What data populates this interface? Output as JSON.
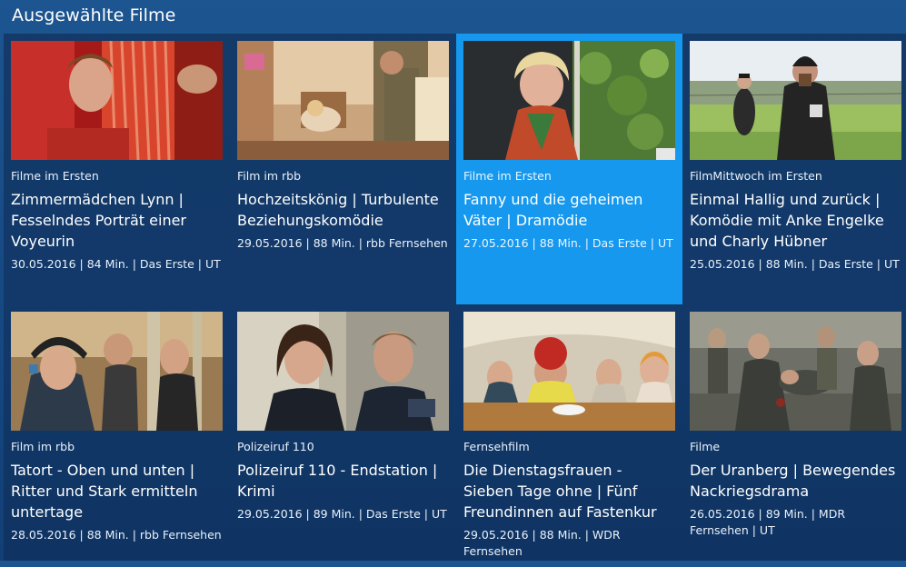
{
  "header": {
    "title": "Ausgewählte Filme"
  },
  "films": [
    {
      "channel": "Filme im Ersten",
      "title": "Zimmermädchen Lynn | Fesselndes Porträt einer Voyeurin",
      "meta": "30.05.2016 | 84 Min. | Das Erste | UT",
      "active": false
    },
    {
      "channel": "Film im rbb",
      "title": "Hochzeitskönig | Turbulente Beziehungskomödie",
      "meta": "29.05.2016 | 88 Min. | rbb Fernsehen",
      "active": false
    },
    {
      "channel": "Filme im Ersten",
      "title": "Fanny und die geheimen Väter | Dramödie",
      "meta": "27.05.2016 | 88 Min. | Das Erste | UT",
      "active": true
    },
    {
      "channel": "FilmMittwoch im Ersten",
      "title": "Einmal Hallig und zurück | Komödie mit Anke Engelke und Charly Hübner",
      "meta": "25.05.2016 | 88 Min. | Das Erste | UT",
      "active": false
    },
    {
      "channel": "Film im rbb",
      "title": "Tatort - Oben und unten | Ritter und Stark ermitteln untertage",
      "meta": "28.05.2016 | 88 Min. | rbb Fernsehen",
      "active": false
    },
    {
      "channel": "Polizeiruf 110",
      "title": "Polizeiruf 110 - Endstation | Krimi",
      "meta": "29.05.2016 | 89 Min. | Das Erste | UT",
      "active": false
    },
    {
      "channel": "Fernsehfilm",
      "title": "Die Dienstagsfrauen - Sieben Tage ohne | Fünf Freundinnen auf Fastenkur",
      "meta": "29.05.2016 | 88 Min. | WDR Fernsehen",
      "active": false
    },
    {
      "channel": "Filme",
      "title": "Der Uranberg | Bewegendes Nackriegsdrama",
      "meta": "26.05.2016 | 89 Min. | MDR Fernsehen | UT",
      "active": false
    }
  ],
  "colors": {
    "background": "#1c5590",
    "panel": "#133a68",
    "active_card": "#1598ee",
    "text": "#ffffff"
  }
}
